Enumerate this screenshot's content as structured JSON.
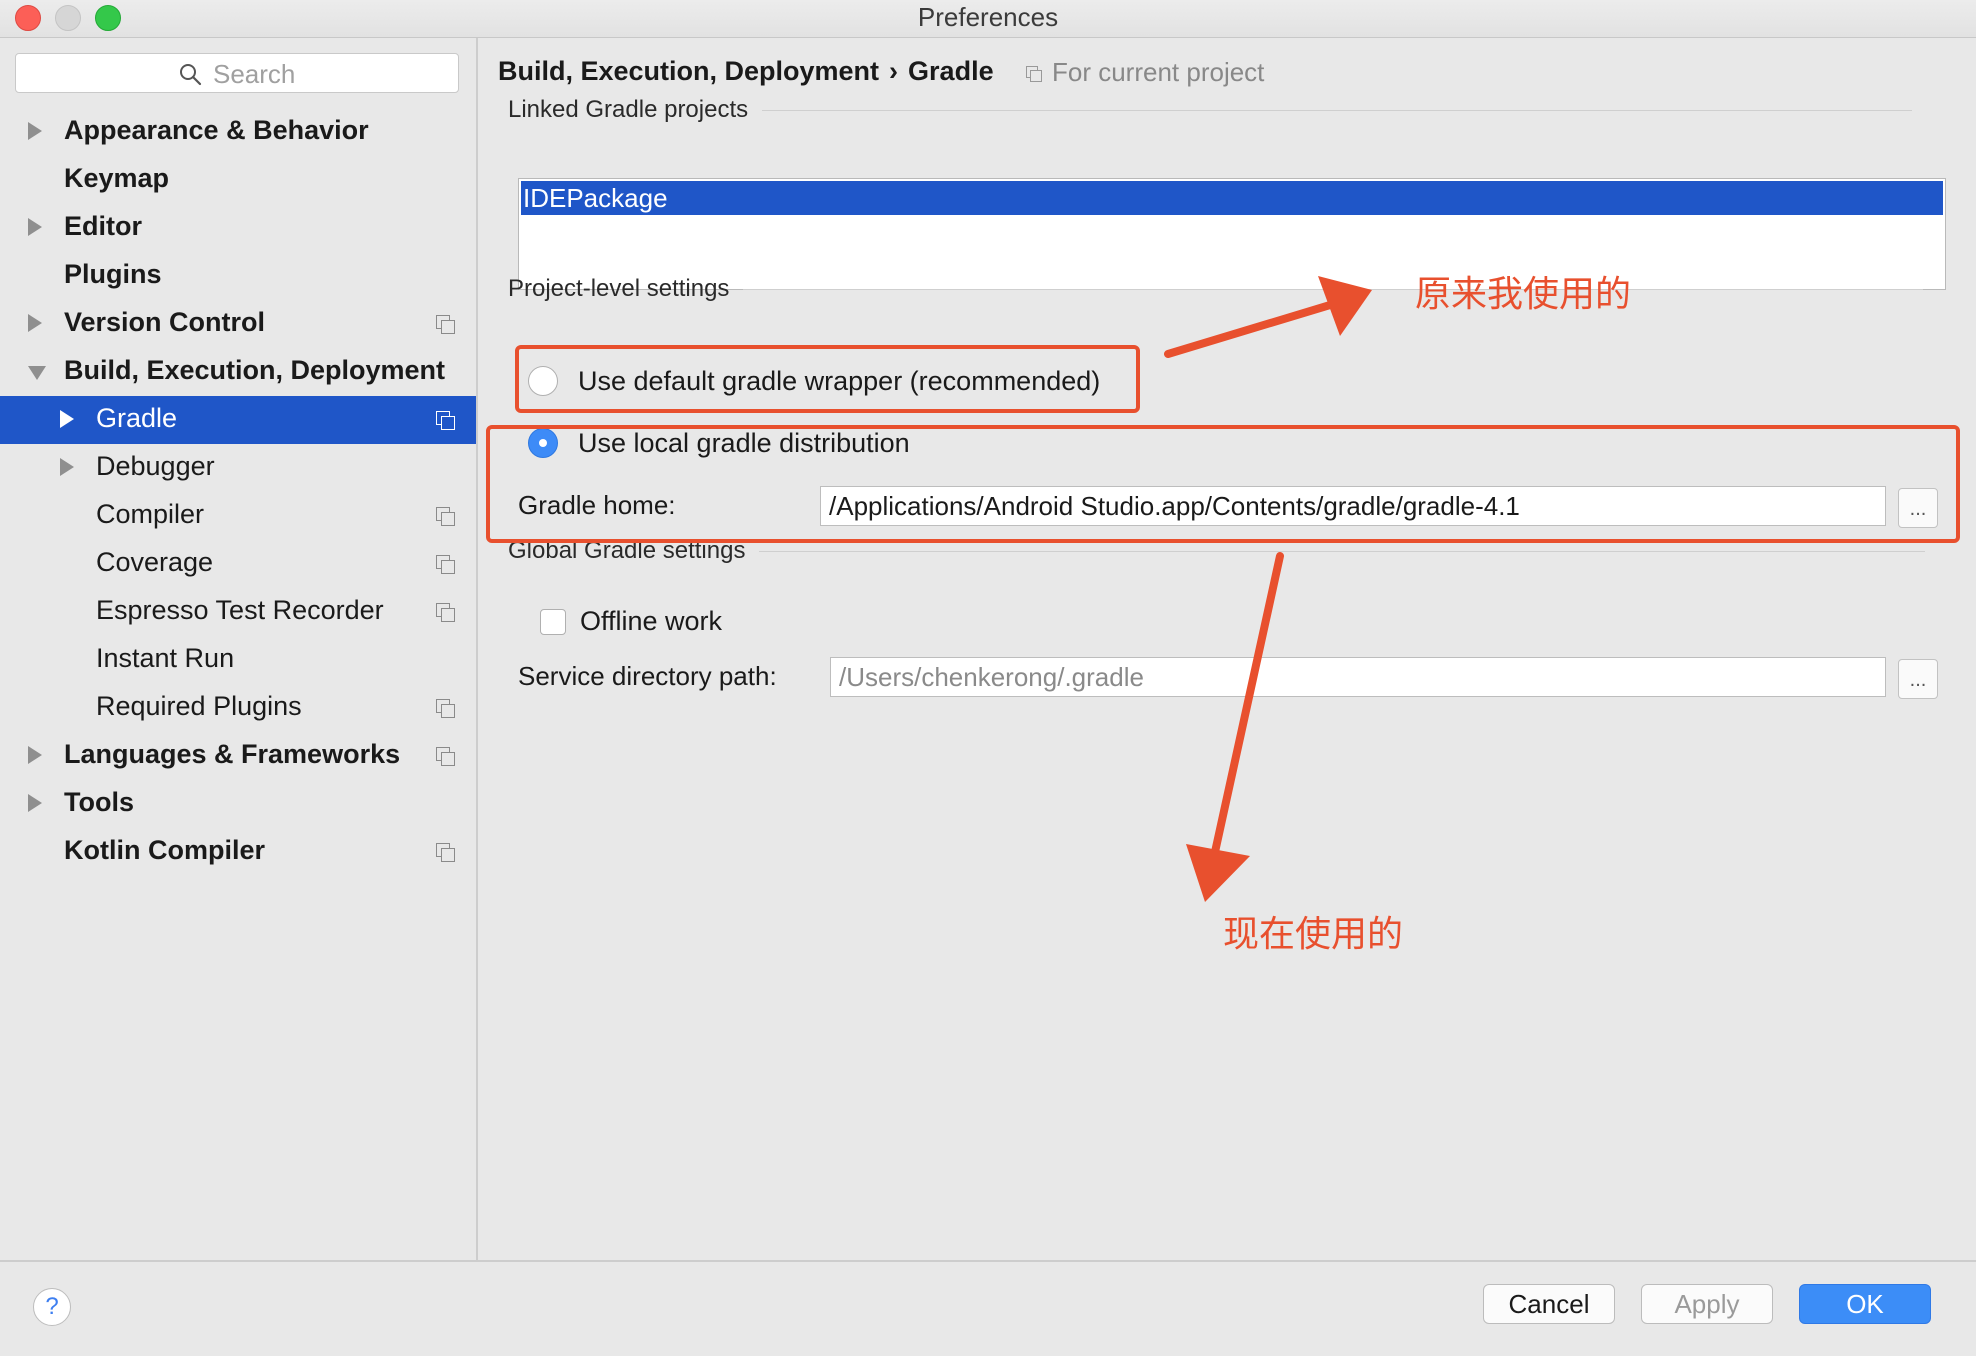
{
  "window": {
    "title": "Preferences"
  },
  "sidebar": {
    "search_placeholder": "Search",
    "items": [
      {
        "label": "Appearance & Behavior",
        "level": 0,
        "arrow": "right",
        "bold": true,
        "icon": false,
        "selected": false
      },
      {
        "label": "Keymap",
        "level": 0,
        "arrow": "none",
        "bold": true,
        "icon": false,
        "selected": false
      },
      {
        "label": "Editor",
        "level": 0,
        "arrow": "right",
        "bold": true,
        "icon": false,
        "selected": false
      },
      {
        "label": "Plugins",
        "level": 0,
        "arrow": "none",
        "bold": true,
        "icon": false,
        "selected": false
      },
      {
        "label": "Version Control",
        "level": 0,
        "arrow": "right",
        "bold": true,
        "icon": true,
        "selected": false
      },
      {
        "label": "Build, Execution, Deployment",
        "level": 0,
        "arrow": "down",
        "bold": true,
        "icon": false,
        "selected": false
      },
      {
        "label": "Gradle",
        "level": 1,
        "arrow": "right",
        "bold": false,
        "icon": true,
        "selected": true
      },
      {
        "label": "Debugger",
        "level": 1,
        "arrow": "right",
        "bold": false,
        "icon": false,
        "selected": false
      },
      {
        "label": "Compiler",
        "level": 1,
        "arrow": "none",
        "bold": false,
        "icon": true,
        "selected": false
      },
      {
        "label": "Coverage",
        "level": 1,
        "arrow": "none",
        "bold": false,
        "icon": true,
        "selected": false
      },
      {
        "label": "Espresso Test Recorder",
        "level": 1,
        "arrow": "none",
        "bold": false,
        "icon": true,
        "selected": false
      },
      {
        "label": "Instant Run",
        "level": 1,
        "arrow": "none",
        "bold": false,
        "icon": false,
        "selected": false
      },
      {
        "label": "Required Plugins",
        "level": 1,
        "arrow": "none",
        "bold": false,
        "icon": true,
        "selected": false
      },
      {
        "label": "Languages & Frameworks",
        "level": 0,
        "arrow": "right",
        "bold": true,
        "icon": true,
        "selected": false
      },
      {
        "label": "Tools",
        "level": 0,
        "arrow": "right",
        "bold": true,
        "icon": false,
        "selected": false
      },
      {
        "label": "Kotlin Compiler",
        "level": 0,
        "arrow": "none",
        "bold": true,
        "icon": true,
        "selected": false
      }
    ]
  },
  "main": {
    "breadcrumb": {
      "parent": "Build, Execution, Deployment",
      "separator": "›",
      "current": "Gradle"
    },
    "scope": "For current project",
    "linked_section": "Linked Gradle projects",
    "linked_projects": [
      "IDEPackage"
    ],
    "project_section": "Project-level settings",
    "option_default": "Use default gradle wrapper (recommended)",
    "option_local": "Use local gradle distribution",
    "selected_option": "local",
    "gradle_home_label": "Gradle home:",
    "gradle_home_value": "/Applications/Android Studio.app/Contents/gradle/gradle-4.1",
    "global_section": "Global Gradle settings",
    "offline_label": "Offline work",
    "offline_checked": false,
    "service_dir_label": "Service directory path:",
    "service_dir_value": "/Users/chenkerong/.gradle",
    "browse_label": "..."
  },
  "annotations": {
    "color": "#e8502e",
    "before_text": "原来我使用的",
    "after_text": "现在使用的"
  },
  "footer": {
    "help": "?",
    "cancel": "Cancel",
    "apply": "Apply",
    "ok": "OK"
  },
  "colors": {
    "selection": "#1f56c8",
    "primary_button": "#3c8df7",
    "background": "#e8e8e8"
  }
}
